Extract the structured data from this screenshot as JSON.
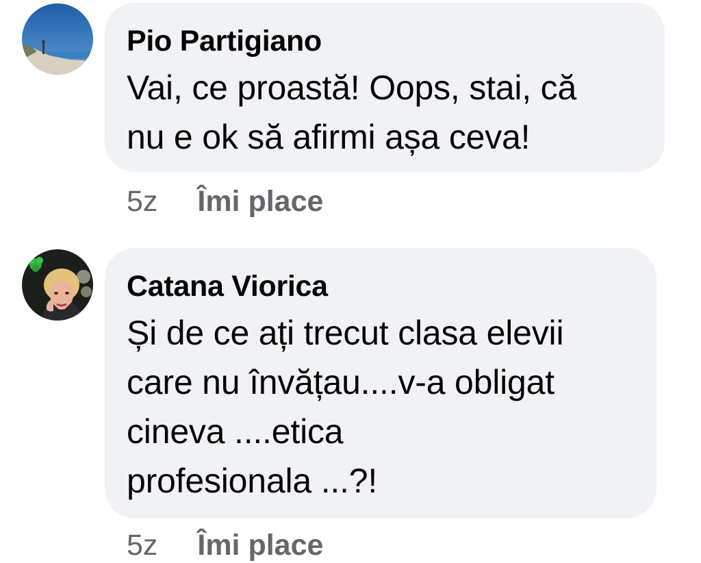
{
  "comments": [
    {
      "author": "Pio Partigiano",
      "lines": [
        "Vai, ce proastă! Oops, stai, că",
        "nu e ok să afirmi așa ceva!"
      ],
      "time": "5z",
      "like_label": "Îmi place",
      "avatar_icon": "beach-photo-avatar"
    },
    {
      "author": "Catana Viorica",
      "lines": [
        "Și de ce ați trecut clasa elevii",
        "care nu învățau....v-a obligat",
        "cineva ....etica",
        "profesionala ...?!"
      ],
      "time": "5z",
      "like_label": "Îmi place",
      "avatar_icon": "woman-photo-avatar"
    }
  ],
  "colors": {
    "bubble": "#f0f2f5",
    "meta_text": "#65676b",
    "text": "#050505"
  }
}
